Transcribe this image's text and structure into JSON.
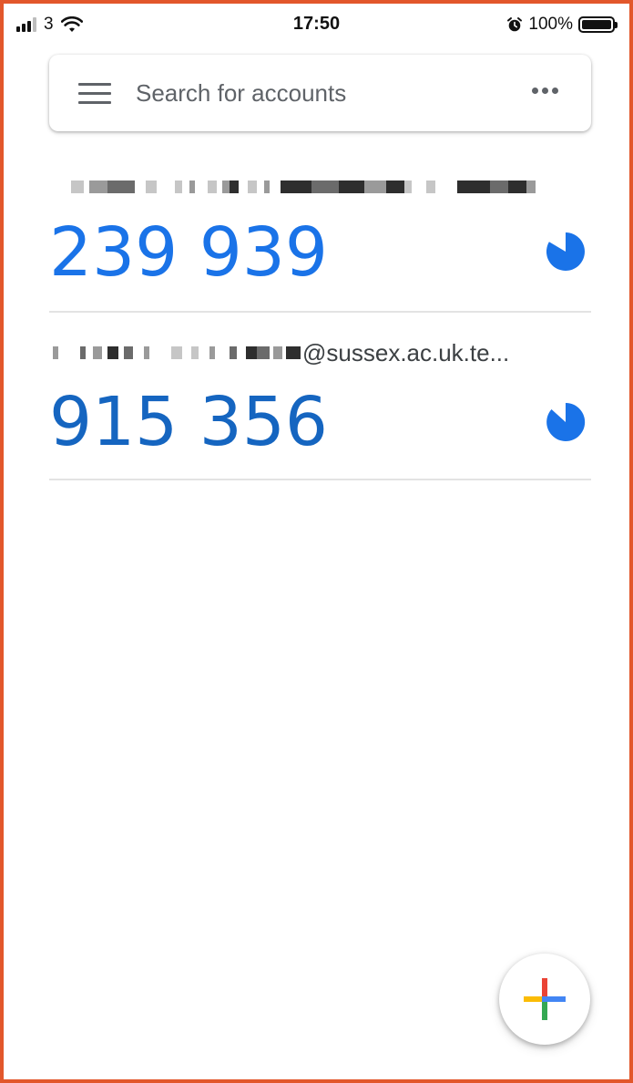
{
  "status_bar": {
    "carrier": "3",
    "time": "17:50",
    "battery": "100%"
  },
  "search": {
    "placeholder": "Search for accounts"
  },
  "accounts": [
    {
      "label": "",
      "code": "239 939",
      "timer_color": "#1a73e8"
    },
    {
      "label": "@sussex.ac.uk.te...",
      "code": "915 356",
      "timer_color": "#1a73e8"
    }
  ],
  "icons": {
    "menu": "menu-icon",
    "more": "more-vert-icon",
    "add": "add-icon"
  },
  "colors": {
    "frame_border": "#e2572b",
    "code_blue": "#1a73e8",
    "google_blue": "#4285f4",
    "google_red": "#ea4335",
    "google_yellow": "#fbbc05",
    "google_green": "#34a853"
  }
}
